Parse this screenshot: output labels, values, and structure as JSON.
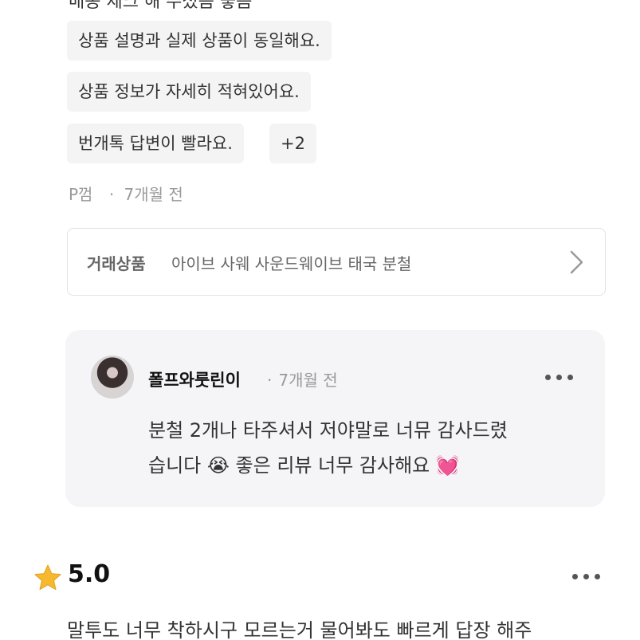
{
  "review": {
    "cut_text": "배송 체크 해 주셨음 좋음",
    "tags": [
      "상품 설명과 실제 상품이 동일해요.",
      "상품 정보가 자세히 적혀있어요.",
      "번개톡 답변이 빨라요."
    ],
    "more_tags": "+2",
    "author": "P껌",
    "separator": "·",
    "time": "7개월 전"
  },
  "product": {
    "label": "거래상품",
    "name": "아이브 사웨 사운드웨이브 태국 분철",
    "icon": "chevron-right-icon"
  },
  "reply": {
    "seller": "폴프와룻린이",
    "separator": "·",
    "time": "7개월 전",
    "line1": "분철 2개나 타주셔서 저야말로 너뮤 감사드렸",
    "line2": "습니다 😭 좋은 리뷰 너무 감사해요 💓",
    "more_icon": "more-icon"
  },
  "next_review": {
    "star_icon": "star-icon",
    "rating": "5.0",
    "text": "말투도 너무 착하시구 모르는거 물어봐도 빠르게 답장 해주",
    "more_icon": "more-icon"
  },
  "colors": {
    "star": "#f5b82e",
    "chip_bg": "#f4f4f5",
    "reply_bg": "#f5f5f7"
  }
}
